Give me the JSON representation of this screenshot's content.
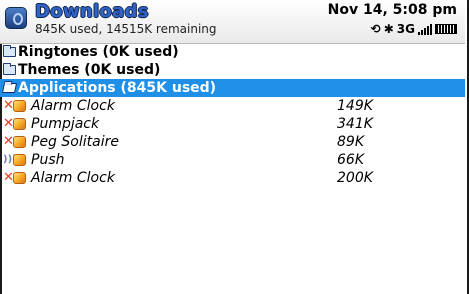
{
  "header": {
    "title": "Downloads",
    "subtitle": "845K used, 14515K remaining",
    "datetime": "Nov 14, 5:08 pm",
    "network": "3G",
    "icons": [
      "downloads-app-icon",
      "bluetooth-icon",
      "signal-icon",
      "battery-icon"
    ]
  },
  "folders": [
    {
      "label": "Ringtones (0K used)",
      "open": false
    },
    {
      "label": "Themes (0K used)",
      "open": false
    },
    {
      "label": "Applications (845K used)",
      "open": true,
      "selected": true
    }
  ],
  "items": [
    {
      "name": "Alarm Clock",
      "size": "149K",
      "status": "error"
    },
    {
      "name": "Pumpjack",
      "size": "341K",
      "status": "error"
    },
    {
      "name": "Peg Solitaire",
      "size": "89K",
      "status": "error"
    },
    {
      "name": "Push",
      "size": "66K",
      "status": "push"
    },
    {
      "name": "Alarm Clock",
      "size": "200K",
      "status": "error"
    }
  ],
  "colors": {
    "selection": "#1f8fe8",
    "title": "#2f63c8",
    "error": "#e53a1c"
  }
}
